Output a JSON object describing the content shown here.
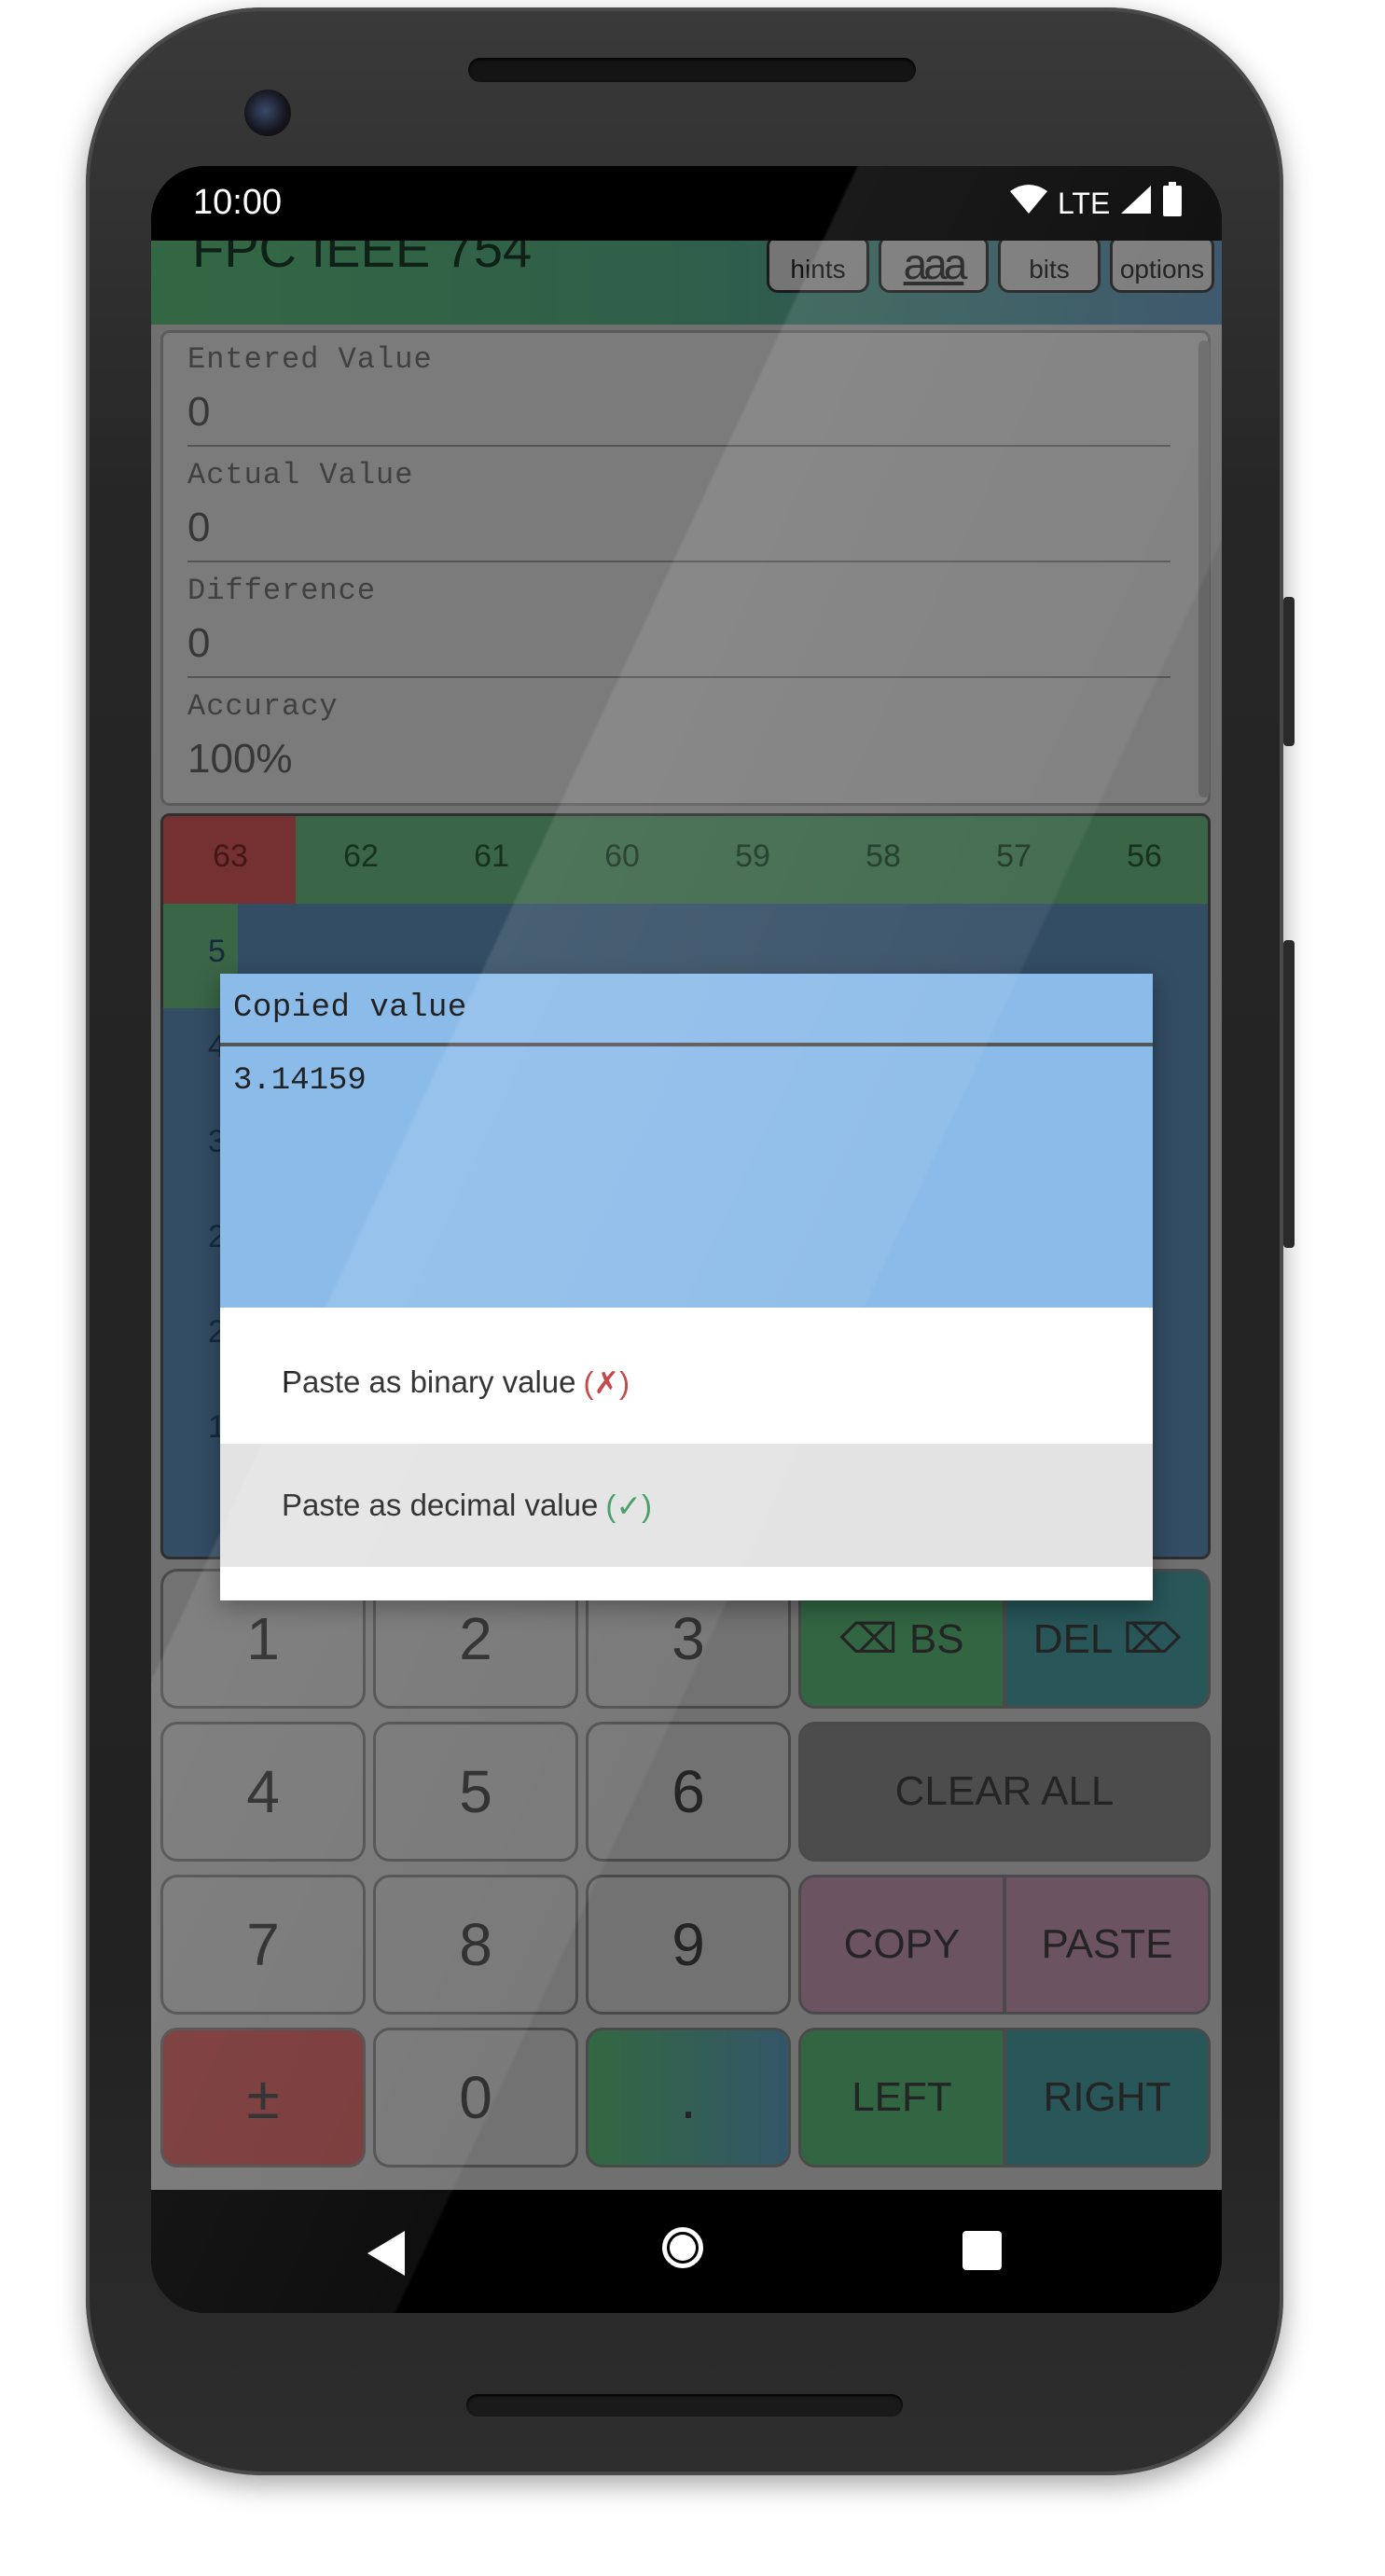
{
  "status_bar": {
    "time": "10:00",
    "network": "LTE"
  },
  "app": {
    "title": "FPC IEEE 754",
    "header_buttons": {
      "hints": "hints",
      "font_size": "aaa",
      "bits": "bits",
      "options": "options"
    },
    "values": [
      {
        "label": "Entered Value",
        "value": "0"
      },
      {
        "label": "Actual Value",
        "value": "0"
      },
      {
        "label": "Difference",
        "value": "0"
      },
      {
        "label": "Accuracy",
        "value": "100%"
      }
    ],
    "bits_header": [
      "63",
      "62",
      "61",
      "60",
      "59",
      "58",
      "57",
      "56"
    ],
    "bits_side_digits": [
      "5",
      "4",
      "3",
      "2",
      "2",
      "1"
    ],
    "keypad": {
      "k1": "1",
      "k2": "2",
      "k3": "3",
      "k4": "4",
      "k5": "5",
      "k6": "6",
      "k7": "7",
      "k8": "8",
      "k9": "9",
      "k0": "0",
      "sign": "±",
      "dot": ".",
      "bs": "⌫ BS",
      "del": "DEL ⌦",
      "clear_all": "CLEAR ALL",
      "copy": "COPY",
      "paste": "PASTE",
      "left": "LEFT",
      "right": "RIGHT"
    }
  },
  "dialog": {
    "title": "Copied value",
    "value": "3.14159",
    "options": [
      {
        "label": "Paste as binary value",
        "mark": "(✗)",
        "state": "invalid"
      },
      {
        "label": "Paste as decimal value",
        "mark": "(✓)",
        "state": "valid"
      }
    ]
  },
  "colors": {
    "dialog_title_bg": "#8bbbe9",
    "bit_sign": "#d85b5b",
    "bit_exponent": "#6cbb83",
    "bit_mantissa": "#5f8fb9",
    "invalid_mark": "#c23b3b",
    "valid_mark": "#3a9a5e"
  },
  "icons": {
    "status": [
      "wifi-icon",
      "signal-icon",
      "battery-icon"
    ],
    "nav": [
      "back-icon",
      "home-icon",
      "recents-icon"
    ]
  }
}
